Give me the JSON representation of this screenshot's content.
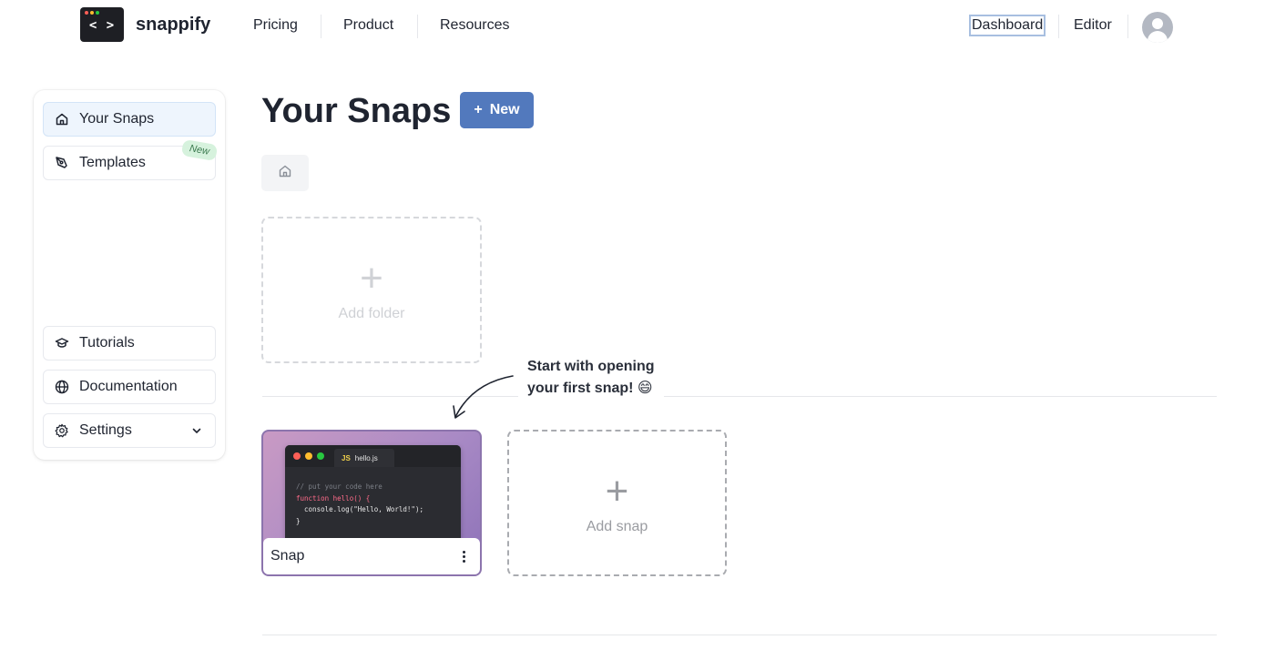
{
  "header": {
    "brand": "snappify",
    "logo_glyph": "< >",
    "nav_left": [
      "Pricing",
      "Product",
      "Resources"
    ],
    "nav_right": [
      "Dashboard",
      "Editor"
    ]
  },
  "sidebar": {
    "items": [
      {
        "label": "Your Snaps",
        "icon": "home-icon"
      },
      {
        "label": "Templates",
        "icon": "pen-nib-icon",
        "badge": "New"
      }
    ],
    "bottom_items": [
      {
        "label": "Tutorials",
        "icon": "graduation-cap-icon"
      },
      {
        "label": "Documentation",
        "icon": "globe-icon"
      },
      {
        "label": "Settings",
        "icon": "gear-icon"
      }
    ]
  },
  "main": {
    "title": "Your Snaps",
    "new_button": "New",
    "add_folder_label": "Add folder",
    "hint_line1": "Start with opening",
    "hint_line2": "your first snap! 😄",
    "snap": {
      "name": "Snap",
      "tab_label": "hello.js",
      "tab_lang": "JS",
      "code": [
        "// put your code here",
        "function hello() {",
        "  console.log(\"Hello, World!\");",
        "}"
      ]
    },
    "add_snap_label": "Add snap"
  },
  "colors": {
    "accent": "#5279bd",
    "badge_bg": "#d6f2dd",
    "active_item_bg": "#eef5fd"
  }
}
